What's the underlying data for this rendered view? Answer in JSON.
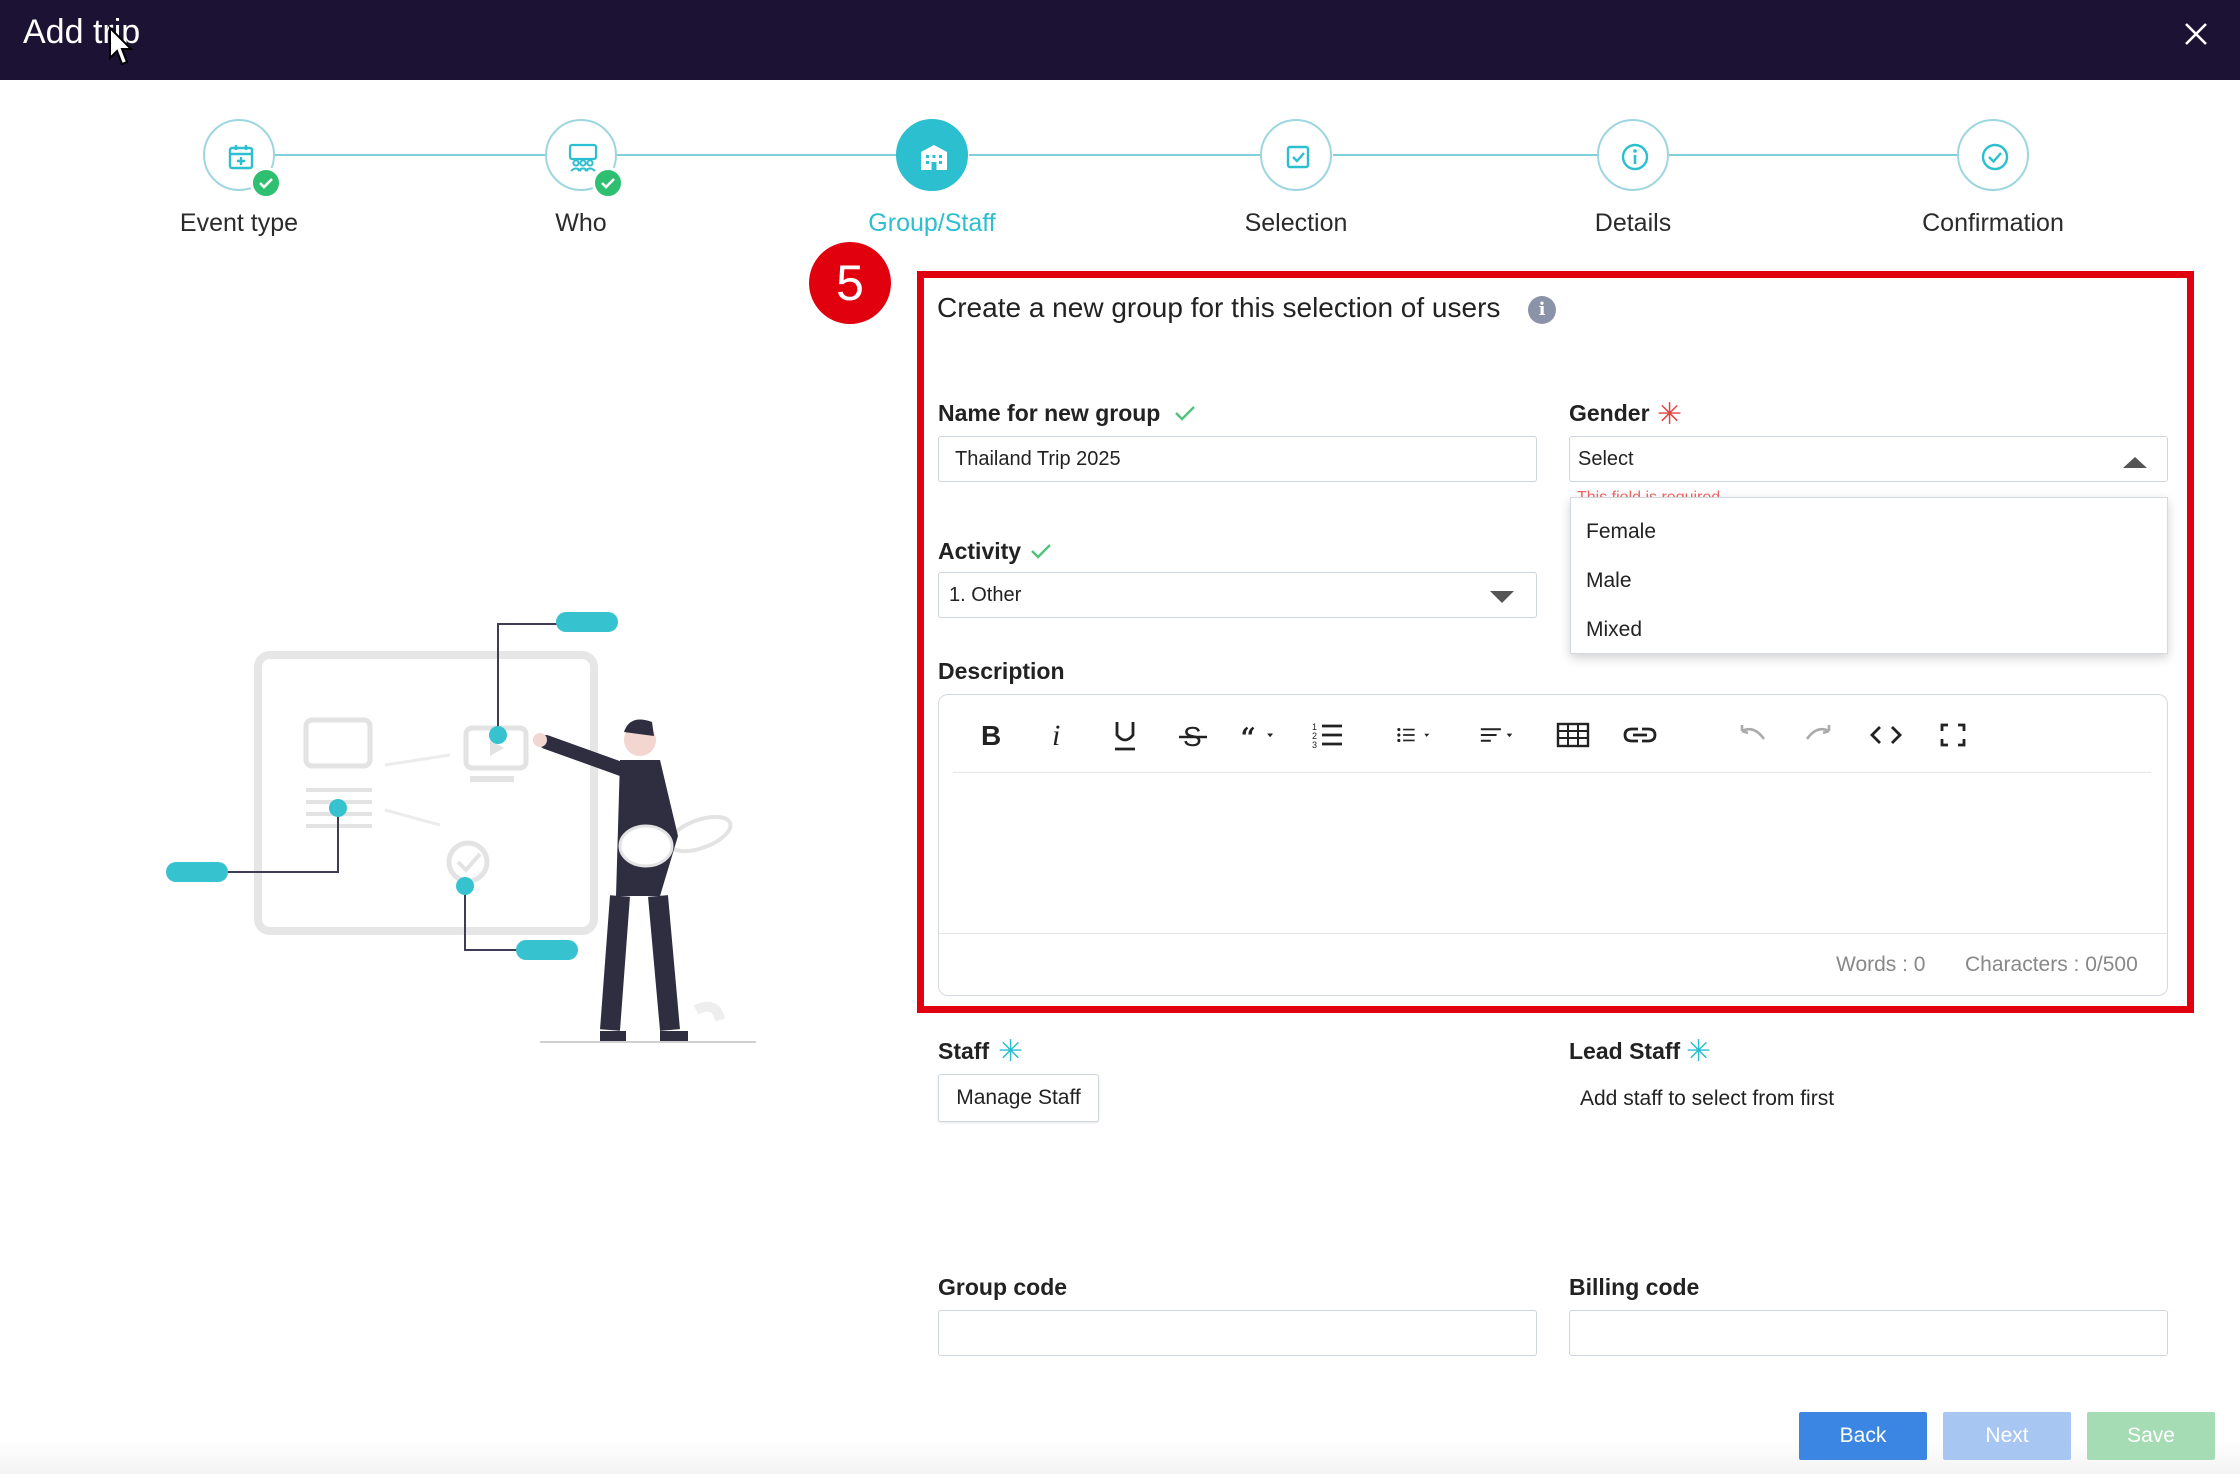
{
  "window": {
    "title": "Add trip"
  },
  "stepper": {
    "steps": [
      {
        "label": "Event type",
        "state": "done",
        "icon": "calendar-add-icon"
      },
      {
        "label": "Who",
        "state": "done",
        "icon": "users-icon"
      },
      {
        "label": "Group/Staff",
        "state": "active",
        "icon": "building-icon"
      },
      {
        "label": "Selection",
        "state": "pending",
        "icon": "checkbox-icon"
      },
      {
        "label": "Details",
        "state": "pending",
        "icon": "info-icon"
      },
      {
        "label": "Confirmation",
        "state": "pending",
        "icon": "check-circle-icon"
      }
    ]
  },
  "badge": {
    "number": "5"
  },
  "form": {
    "title": "Create a new group for this selection of users",
    "name_label": "Name for new group",
    "name_value": "Thailand Trip 2025",
    "gender_label": "Gender",
    "gender_value": "Select",
    "gender_error": "This field is required",
    "gender_options": [
      "Female",
      "Male",
      "Mixed"
    ],
    "activity_label": "Activity",
    "activity_value": "1. Other",
    "description_label": "Description",
    "words_count": "Words : 0",
    "chars_count": "Characters : 0/500",
    "staff_label": "Staff",
    "manage_staff_label": "Manage Staff",
    "lead_staff_label": "Lead Staff",
    "lead_staff_hint": "Add staff to select from first",
    "group_code_label": "Group code",
    "billing_code_label": "Billing code"
  },
  "toolbar": [
    "bold-icon",
    "italic-icon",
    "underline-icon",
    "strikethrough-icon",
    "quote-icon",
    "ordered-list-icon",
    "bullet-list-icon",
    "align-icon",
    "table-icon",
    "link-icon",
    "undo-icon",
    "redo-icon",
    "code-view-icon",
    "fullscreen-icon"
  ],
  "footer": {
    "back_label": "Back",
    "next_label": "Next",
    "save_label": "Save"
  },
  "colors": {
    "header": "#1c1334",
    "accent": "#2bbfcf",
    "highlight": "#e00010",
    "back": "#3c86e3",
    "done": "#2fbf71"
  }
}
